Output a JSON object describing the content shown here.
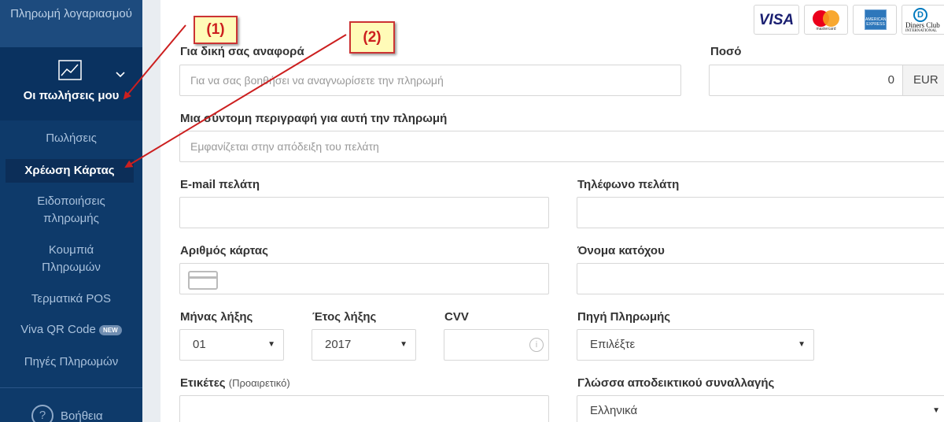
{
  "sidebar": {
    "top_item": "Πληρωμή λογαριασμού",
    "sales_label": "Οι πωλήσεις μου",
    "items": [
      {
        "label": "Πωλήσεις"
      },
      {
        "label": "Χρέωση Κάρτας"
      },
      {
        "label": "Ειδοποιήσεις πληρωμής"
      },
      {
        "label": "Κουμπιά Πληρωμών"
      },
      {
        "label": "Τερματικά POS"
      },
      {
        "label": "Viva QR Code",
        "badge": "NEW"
      },
      {
        "label": "Πηγές Πληρωμών"
      }
    ],
    "help_label": "Βοήθεια"
  },
  "cards": {
    "visa": "VISA",
    "mastercard": "mastercard",
    "amex": "AMERICAN EXPRESS",
    "diners": "Diners Club",
    "diners_sub": "INTERNATIONAL"
  },
  "form": {
    "reference": {
      "label": "Για δική σας αναφορά",
      "placeholder": "Για να σας βοηθήσει να αναγνωρίσετε την πληρωμή"
    },
    "amount": {
      "label": "Ποσό",
      "value": "0",
      "currency": "EUR"
    },
    "description": {
      "label": "Μια σύντομη περιγραφή για αυτή την πληρωμή",
      "placeholder": "Εμφανίζεται στην απόδειξη του πελάτη"
    },
    "email": {
      "label": "E-mail πελάτη",
      "value": ""
    },
    "phone": {
      "label": "Τηλέφωνο πελάτη",
      "value": ""
    },
    "card_number": {
      "label": "Αριθμός κάρτας",
      "value": ""
    },
    "holder": {
      "label": "Όνομα κατόχου",
      "value": ""
    },
    "exp_month": {
      "label": "Μήνας λήξης",
      "value": "01"
    },
    "exp_year": {
      "label": "Έτος λήξης",
      "value": "2017"
    },
    "cvv": {
      "label": "CVV",
      "value": ""
    },
    "source": {
      "label": "Πηγή Πληρωμής",
      "value": "Επιλέξτε"
    },
    "tags": {
      "label": "Ετικέτες",
      "optional": "(Προαιρετικό)"
    },
    "receipt_language": {
      "label": "Γλώσσα αποδεικτικού συναλλαγής",
      "value": "Ελληνικά"
    }
  },
  "annotations": {
    "callout_1": "(1)",
    "callout_2": "(2)",
    "color": "#cc1f1f"
  }
}
